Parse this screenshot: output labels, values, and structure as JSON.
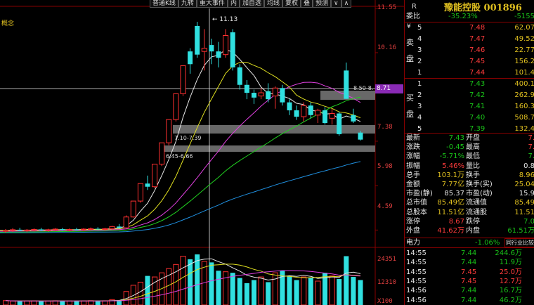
{
  "toolbar": [
    "普通K线",
    "九转",
    "重大事件",
    "内",
    "加自选",
    "均线",
    "复权",
    "叠",
    "预测",
    "∨",
    "∧"
  ],
  "chart": {
    "concept_label": "概念",
    "high_annotation": "11.13",
    "y_labels": [
      "11.55",
      "10.16",
      "8.71",
      "7.38",
      "5.98",
      "4.59"
    ],
    "current_price_tag": "8.71",
    "zone1_label": "8.50-8.",
    "zone2_label": "7.10-7.39",
    "zone3_label": "6.45-6.66",
    "vol_labels": [
      "24351",
      "12310"
    ],
    "vol_unit": "X100"
  },
  "chart_data": {
    "type": "candlestick",
    "candles": [
      {
        "o": 4.55,
        "h": 4.62,
        "l": 4.5,
        "c": 4.58
      },
      {
        "o": 4.58,
        "h": 4.65,
        "l": 4.53,
        "c": 4.6
      },
      {
        "o": 4.6,
        "h": 4.66,
        "l": 4.55,
        "c": 4.57
      },
      {
        "o": 4.57,
        "h": 4.62,
        "l": 4.52,
        "c": 4.59
      },
      {
        "o": 4.59,
        "h": 4.64,
        "l": 4.55,
        "c": 4.61
      },
      {
        "o": 4.61,
        "h": 4.66,
        "l": 4.56,
        "c": 4.58
      },
      {
        "o": 4.58,
        "h": 4.63,
        "l": 4.54,
        "c": 4.6
      },
      {
        "o": 4.6,
        "h": 4.65,
        "l": 4.56,
        "c": 4.62
      },
      {
        "o": 4.62,
        "h": 4.66,
        "l": 4.57,
        "c": 4.59
      },
      {
        "o": 4.59,
        "h": 4.64,
        "l": 4.55,
        "c": 4.61
      },
      {
        "o": 4.61,
        "h": 4.66,
        "l": 4.57,
        "c": 4.6
      },
      {
        "o": 4.6,
        "h": 4.65,
        "l": 4.56,
        "c": 4.62
      },
      {
        "o": 4.62,
        "h": 4.67,
        "l": 4.58,
        "c": 4.63
      },
      {
        "o": 4.63,
        "h": 4.68,
        "l": 4.59,
        "c": 4.61
      },
      {
        "o": 4.61,
        "h": 4.66,
        "l": 4.57,
        "c": 4.63
      },
      {
        "o": 4.63,
        "h": 4.72,
        "l": 4.6,
        "c": 4.7
      },
      {
        "o": 4.7,
        "h": 4.78,
        "l": 4.65,
        "c": 4.66
      },
      {
        "o": 4.66,
        "h": 5.05,
        "l": 4.64,
        "c": 5.0
      },
      {
        "o": 5.0,
        "h": 5.5,
        "l": 4.98,
        "c": 5.5
      },
      {
        "o": 5.5,
        "h": 6.05,
        "l": 5.45,
        "c": 6.05
      },
      {
        "o": 6.05,
        "h": 6.3,
        "l": 5.85,
        "c": 5.95
      },
      {
        "o": 5.95,
        "h": 6.66,
        "l": 5.9,
        "c": 6.66
      },
      {
        "o": 6.66,
        "h": 7.33,
        "l": 6.6,
        "c": 7.33
      },
      {
        "o": 7.33,
        "h": 8.06,
        "l": 7.25,
        "c": 8.06
      },
      {
        "o": 8.06,
        "h": 8.87,
        "l": 8.0,
        "c": 8.87
      },
      {
        "o": 8.87,
        "h": 9.75,
        "l": 8.8,
        "c": 9.75
      },
      {
        "o": 10.2,
        "h": 10.3,
        "l": 9.5,
        "c": 9.8
      },
      {
        "o": 11.0,
        "h": 11.13,
        "l": 10.0,
        "c": 10.1
      },
      {
        "o": 10.2,
        "h": 10.9,
        "l": 9.6,
        "c": 10.3
      },
      {
        "o": 10.4,
        "h": 10.6,
        "l": 9.8,
        "c": 10.2
      },
      {
        "o": 10.2,
        "h": 10.5,
        "l": 9.7,
        "c": 10.0
      },
      {
        "o": 10.1,
        "h": 10.9,
        "l": 10.0,
        "c": 10.7
      },
      {
        "o": 10.8,
        "h": 10.9,
        "l": 9.6,
        "c": 9.7
      },
      {
        "o": 9.7,
        "h": 9.8,
        "l": 9.0,
        "c": 9.15
      },
      {
        "o": 9.15,
        "h": 9.3,
        "l": 8.7,
        "c": 8.9
      },
      {
        "o": 8.9,
        "h": 9.0,
        "l": 8.55,
        "c": 8.75
      },
      {
        "o": 8.8,
        "h": 9.05,
        "l": 8.7,
        "c": 8.9
      },
      {
        "o": 8.95,
        "h": 9.2,
        "l": 8.6,
        "c": 8.7
      },
      {
        "o": 8.8,
        "h": 9.1,
        "l": 8.4,
        "c": 9.05
      },
      {
        "o": 9.05,
        "h": 9.15,
        "l": 8.5,
        "c": 8.6
      },
      {
        "o": 8.6,
        "h": 8.7,
        "l": 8.2,
        "c": 8.35
      },
      {
        "o": 8.35,
        "h": 8.5,
        "l": 8.05,
        "c": 8.15
      },
      {
        "o": 8.15,
        "h": 8.6,
        "l": 8.0,
        "c": 8.5
      },
      {
        "o": 8.5,
        "h": 8.6,
        "l": 8.1,
        "c": 8.2
      },
      {
        "o": 8.2,
        "h": 8.4,
        "l": 7.95,
        "c": 8.35
      },
      {
        "o": 8.35,
        "h": 8.45,
        "l": 7.9,
        "c": 7.95
      },
      {
        "o": 8.1,
        "h": 8.4,
        "l": 7.9,
        "c": 8.25
      },
      {
        "o": 8.25,
        "h": 8.3,
        "l": 7.55,
        "c": 7.6
      },
      {
        "o": 9.6,
        "h": 9.85,
        "l": 8.71,
        "c": 8.71
      },
      {
        "o": 8.2,
        "h": 8.4,
        "l": 7.95,
        "c": 8.0
      },
      {
        "o": 7.65,
        "h": 7.7,
        "l": 7.4,
        "c": 7.43
      }
    ],
    "volumes": [
      2100,
      1900,
      1800,
      1950,
      2000,
      1850,
      1900,
      2050,
      1800,
      1950,
      1900,
      2000,
      2100,
      1950,
      2050,
      2600,
      2300,
      6500,
      9500,
      11000,
      14000,
      13500,
      15500,
      17500,
      19500,
      23500,
      22000,
      24351,
      21000,
      20500,
      16500,
      16000,
      15500,
      13000,
      10500,
      12000,
      13500,
      11000,
      15500,
      16500,
      14000,
      12000,
      13500,
      13000,
      11500,
      15500,
      14000,
      12500,
      23500,
      13500,
      12000
    ]
  },
  "panel": {
    "r_label": "R",
    "stock_name": "豫能控股 001896",
    "weibi_label": "委比",
    "weibi_pct": "-35.23%",
    "weibi_val": "-5155",
    "sell_side": [
      "卖",
      "盘"
    ],
    "buy_side": [
      "买",
      "盘"
    ],
    "yen": "¥",
    "sells": [
      {
        "lv": "5",
        "p": "7.48",
        "v": "62.07"
      },
      {
        "lv": "4",
        "p": "7.47",
        "v": "49.52"
      },
      {
        "lv": "3",
        "p": "7.46",
        "v": "22.77"
      },
      {
        "lv": "2",
        "p": "7.45",
        "v": "156.2"
      },
      {
        "lv": "1",
        "p": "7.44",
        "v": "101.4"
      }
    ],
    "buys": [
      {
        "lv": "1",
        "p": "7.43",
        "v": "400.1"
      },
      {
        "lv": "2",
        "p": "7.42",
        "v": "262.9"
      },
      {
        "lv": "3",
        "p": "7.41",
        "v": "160.3"
      },
      {
        "lv": "4",
        "p": "7.40",
        "v": "508.7"
      },
      {
        "lv": "5",
        "p": "7.39",
        "v": "132.4"
      }
    ],
    "stats": [
      {
        "l1": "最新",
        "v1": "7.43",
        "l2": "开盘",
        "v2": "7.",
        "c1": "green",
        "c2": "red"
      },
      {
        "l1": "涨跌",
        "v1": "-0.45",
        "l2": "最高",
        "v2": "7.",
        "c1": "green",
        "c2": "red"
      },
      {
        "l1": "涨幅",
        "v1": "-5.71%",
        "l2": "最低",
        "v2": "7.",
        "c1": "green",
        "c2": "green"
      },
      {
        "l1": "振幅",
        "v1": "5.46%",
        "l2": "量比",
        "v2": "0.8",
        "c1": "red",
        "c2": "wht"
      },
      {
        "l1": "总手",
        "v1": "103.1万",
        "l2": "换手",
        "v2": "8.96",
        "c1": "yel",
        "c2": "yel"
      },
      {
        "l1": "金额",
        "v1": "7.77亿",
        "l2": "换手(实)",
        "v2": "25.04",
        "c1": "yel",
        "c2": "yel"
      },
      {
        "l1": "市盈(静)",
        "v1": "85.37",
        "l2": "市盈(动)",
        "v2": "15.9",
        "c1": "wht",
        "c2": "wht"
      },
      {
        "l1": "总市值",
        "v1": "85.49亿",
        "l2": "流通值",
        "v2": "85.49",
        "c1": "yel",
        "c2": "yel"
      },
      {
        "l1": "总股本",
        "v1": "11.51亿",
        "l2": "流通股",
        "v2": "11.51",
        "c1": "yel",
        "c2": "yel"
      },
      {
        "l1": "涨停",
        "v1": "8.67",
        "l2": "跌停",
        "v2": "7.0",
        "c1": "red",
        "c2": "green"
      },
      {
        "l1": "外盘",
        "v1": "41.62万",
        "l2": "内盘",
        "v2": "61.51万",
        "c1": "red",
        "c2": "green"
      }
    ],
    "sector_row": {
      "label": "电力",
      "pct": "-1.06%",
      "tab": "同行业比较"
    },
    "ticks": [
      {
        "t": "14:55",
        "p": "7.44",
        "v": "244.6万",
        "c": "green",
        "u": "万"
      },
      {
        "t": "14:55",
        "p": "7.44",
        "v": "11.9万",
        "c": "green",
        "u": "万"
      },
      {
        "t": "14:55",
        "p": "7.45",
        "v": "25.0万",
        "c": "red",
        "u": "万"
      },
      {
        "t": "14:55",
        "p": "7.45",
        "v": "12.7万",
        "c": "red",
        "u": "万"
      },
      {
        "t": "14:56",
        "p": "7.44",
        "v": "16.7万",
        "c": "green",
        "u": "万"
      },
      {
        "t": "14:56",
        "p": "7.44",
        "v": "46.2万",
        "c": "green",
        "u": "万"
      }
    ]
  }
}
